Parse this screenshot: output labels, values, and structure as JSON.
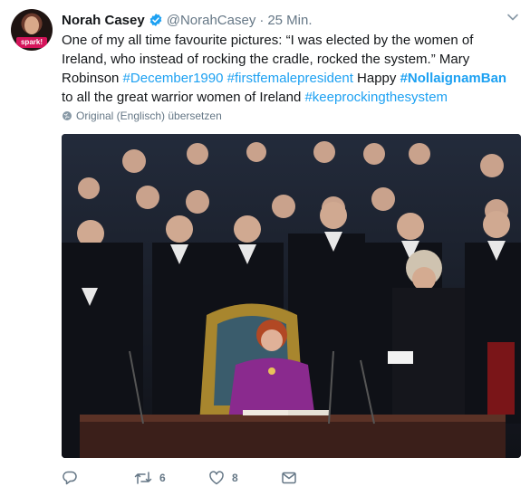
{
  "tweet": {
    "author_name": "Norah Casey",
    "handle": "@NorahCasey",
    "separator": "·",
    "time": "25 Min.",
    "avatar_badge": "spark!",
    "text_parts": {
      "p1": "One of my all time favourite pictures: “I was elected by the women of Ireland, who instead of rocking the cradle, rocked the system.” Mary Robinson ",
      "tag1": "#December1990",
      "tag2": "#firstfemalepresident",
      "p2": " Happy ",
      "tag3": "#NollaignamBan",
      "p3": " to all the great warrior women of Ireland ",
      "tag4": "#keeprockingthesystem"
    },
    "translate_label": "Original (Englisch) übersetzen",
    "retweet_count": "6",
    "like_count": "8"
  },
  "colors": {
    "link": "#1da1f2",
    "muted": "#657786",
    "text": "#14171a",
    "verified": "#1da1f2"
  },
  "icons": [
    "verified-icon",
    "chevron-down-icon",
    "globe-icon",
    "reply-icon",
    "retweet-icon",
    "like-icon",
    "message-icon"
  ]
}
